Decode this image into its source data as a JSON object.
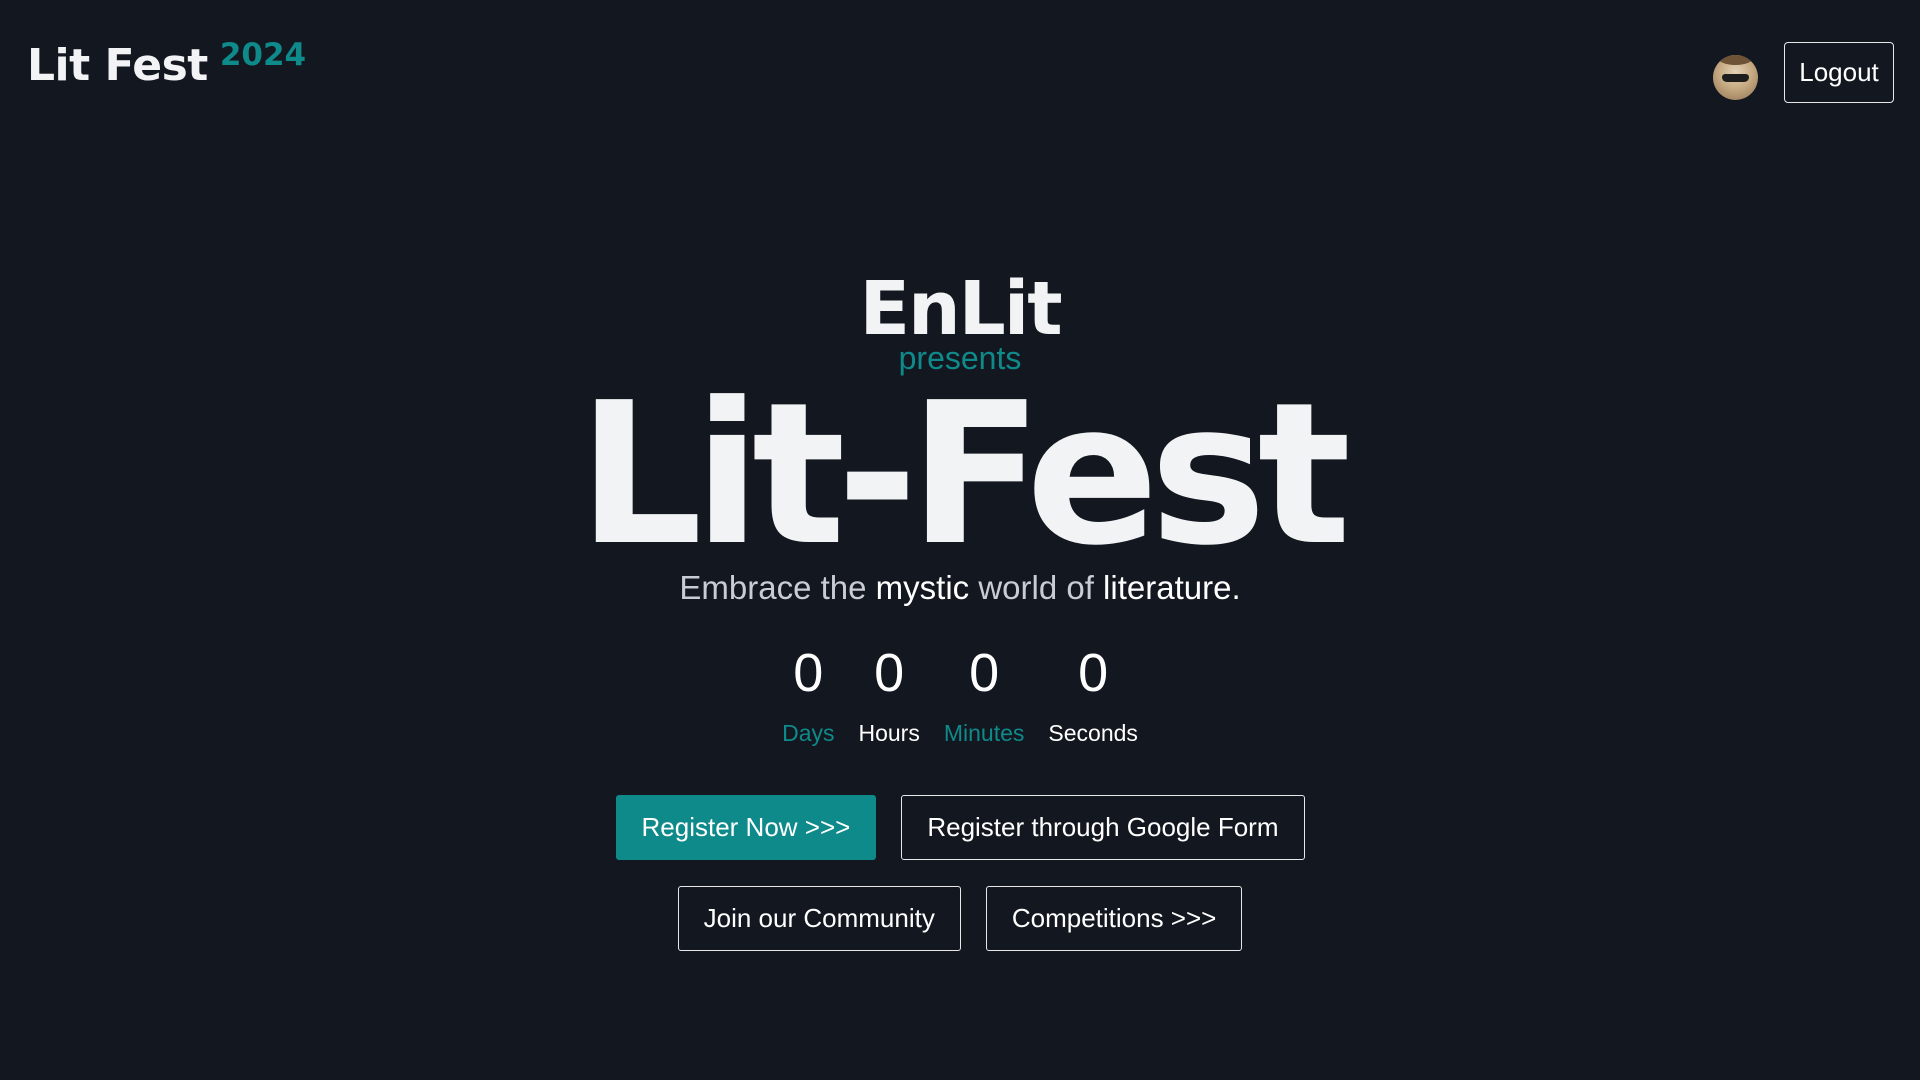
{
  "header": {
    "brand_name": "Lit Fest",
    "brand_year": "2024",
    "logout_label": "Logout",
    "avatar": "user-avatar"
  },
  "hero": {
    "presenter": "EnLit",
    "presents": "presents",
    "title": "Lit-Fest",
    "tagline": {
      "part1": "Embrace the ",
      "highlight1": "mystic",
      "part2": " world of ",
      "highlight2": "literature",
      "part3": "."
    }
  },
  "countdown": [
    {
      "value": "0",
      "label": "Days"
    },
    {
      "value": "0",
      "label": "Hours"
    },
    {
      "value": "0",
      "label": "Minutes"
    },
    {
      "value": "0",
      "label": "Seconds"
    }
  ],
  "actions": {
    "register_now": "Register Now >>>",
    "register_google_form": "Register through Google Form",
    "join_community": "Join our Community",
    "competitions": "Competitions >>>"
  },
  "colors": {
    "background": "#131720",
    "accent": "#0f8a8a",
    "text": "#f2f3f5"
  }
}
